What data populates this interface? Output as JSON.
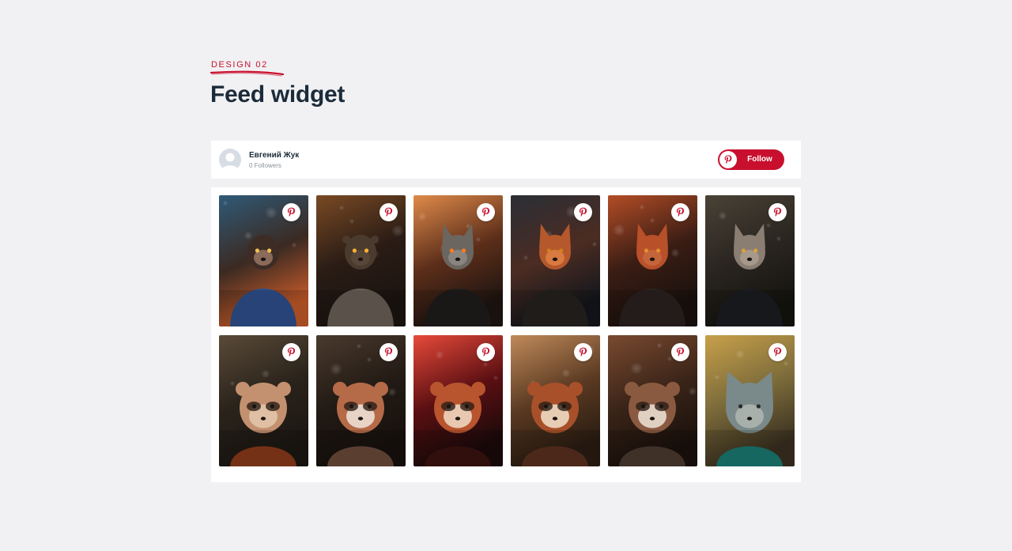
{
  "section": {
    "label": "DESIGN 02",
    "title": "Feed widget"
  },
  "profile": {
    "name": "Евгений Жук",
    "followers": "0 Followers",
    "follow_label": "Follow"
  },
  "colors": {
    "accent": "#c8102e",
    "title": "#1c2b3a",
    "background": "#f1f1f3"
  },
  "pins": [
    {
      "subject": "chimpanzee superhero",
      "bg": [
        "#2f5a78",
        "#3b2a22",
        "#c45a2a"
      ],
      "animal": "#3d2c26",
      "outfit": "#2e4f8c",
      "face": "#8a6a58",
      "eyes": "#f0c050",
      "ears": "pointed-none"
    },
    {
      "subject": "armored beast warrior",
      "bg": [
        "#7a4a24",
        "#2a1c15",
        "#1b1410"
      ],
      "animal": "#4b3a2e",
      "outfit": "#6a6058",
      "face": "#57463a",
      "eyes": "#ffb030",
      "ears": "small"
    },
    {
      "subject": "fox warriors in armor",
      "bg": [
        "#e08b4a",
        "#5c2e1a",
        "#1e1410"
      ],
      "animal": "#6b6660",
      "outfit": "#1f1d1c",
      "face": "#8a8480",
      "eyes": "#ff7a20",
      "ears": "fox"
    },
    {
      "subject": "fox soldier in dark street",
      "bg": [
        "#2a2e36",
        "#4b2c22",
        "#13161c"
      ],
      "animal": "#b5582c",
      "outfit": "#26211e",
      "face": "#d97a40",
      "eyes": "#d08020",
      "ears": "fox"
    },
    {
      "subject": "fox warrior with sparks",
      "bg": [
        "#b44d26",
        "#3a1d14",
        "#1a110d"
      ],
      "animal": "#b8502a",
      "outfit": "#2a2220",
      "face": "#c4643a",
      "eyes": "#e09030",
      "ears": "fox"
    },
    {
      "subject": "grey fox in leather armor",
      "bg": [
        "#4a4236",
        "#2a2520",
        "#15140f"
      ],
      "animal": "#8a7e72",
      "outfit": "#1b1d22",
      "face": "#a6988a",
      "eyes": "#d8a040",
      "ears": "fox"
    },
    {
      "subject": "raccoon with headband",
      "bg": [
        "#5a4a38",
        "#2a231b",
        "#1c1712"
      ],
      "animal": "#c49170",
      "outfit": "#8a3a1a",
      "face": "#e0c0a4",
      "eyes": "#1a1410",
      "ears": "round"
    },
    {
      "subject": "red panda portrait",
      "bg": [
        "#4a3a2e",
        "#221a14",
        "#17110d"
      ],
      "animal": "#b56a48",
      "outfit": "#6a4a3a",
      "face": "#e8d4c6",
      "eyes": "#1a1410",
      "ears": "round"
    },
    {
      "subject": "red panda with lightsaber",
      "bg": [
        "#e84a3a",
        "#5a0f12",
        "#1a0a0a"
      ],
      "animal": "#b8542e",
      "outfit": "#3a1210",
      "face": "#e8c8b0",
      "eyes": "#1a1410",
      "ears": "round"
    },
    {
      "subject": "red panda in bokeh lights",
      "bg": [
        "#c08a5a",
        "#5a3a22",
        "#2a1c12"
      ],
      "animal": "#a8502a",
      "outfit": "#5a3020",
      "face": "#e6cdb4",
      "eyes": "#1a1410",
      "ears": "round"
    },
    {
      "subject": "ferret in armor",
      "bg": [
        "#7a4a30",
        "#3a2418",
        "#1a110c"
      ],
      "animal": "#8a5a40",
      "outfit": "#4a3a30",
      "face": "#e0d0c2",
      "eyes": "#1a1410",
      "ears": "round"
    },
    {
      "subject": "cat in teal armor",
      "bg": [
        "#c8a04a",
        "#7a6a3a",
        "#3a3020"
      ],
      "animal": "#7a8a8a",
      "outfit": "#1a7a70",
      "face": "#a8b0ac",
      "eyes": "#2a2a2a",
      "ears": "cat"
    }
  ]
}
